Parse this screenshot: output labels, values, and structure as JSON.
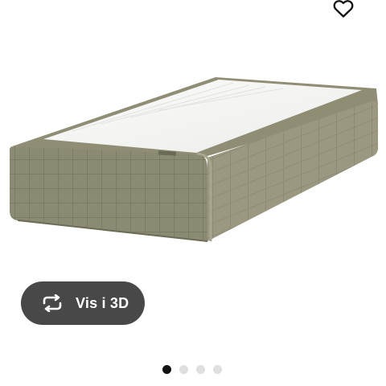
{
  "product": {
    "image_icon": "bed-base-image",
    "favorite_icon": "heart-icon"
  },
  "view_3d": {
    "label": "Vis i 3D",
    "icon": "rotate-icon"
  },
  "carousel": {
    "total": 4,
    "active_index": 0
  },
  "colors": {
    "button_bg": "#484848",
    "dot_active": "#111111",
    "dot_inactive": "#dfdfdf",
    "fabric": "#8b8a70",
    "mattress_top": "#f4f4f2"
  }
}
